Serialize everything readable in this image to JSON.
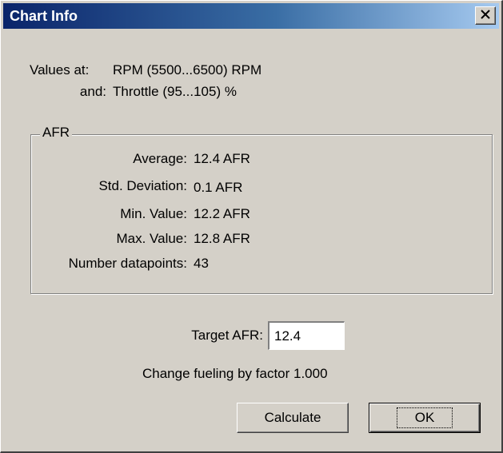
{
  "window": {
    "title": "Chart Info"
  },
  "values_at": {
    "label": "Values at:",
    "value": "RPM (5500...6500) RPM",
    "and_label": "and:",
    "and_value": "Throttle (95...105) %"
  },
  "afr_group": {
    "legend": "AFR",
    "stats": [
      {
        "label": "Average:",
        "value": "12.4 AFR"
      },
      {
        "label": "Std. Deviation:",
        "value": "0.1 AFR"
      },
      {
        "label": "Min. Value:",
        "value": "12.2 AFR"
      },
      {
        "label": "Max. Value:",
        "value": "12.8 AFR"
      },
      {
        "label": "Number datapoints:",
        "value": "43"
      }
    ]
  },
  "target": {
    "label": "Target AFR:",
    "value": "12.4"
  },
  "result_text": "Change fueling by factor 1.000",
  "buttons": {
    "calculate": "Calculate",
    "ok": "OK"
  },
  "icons": {
    "close": "close-icon"
  },
  "colors": {
    "titlebar_start": "#0a246a",
    "titlebar_end": "#a6caf0",
    "dialog_face": "#d4d0c8"
  }
}
